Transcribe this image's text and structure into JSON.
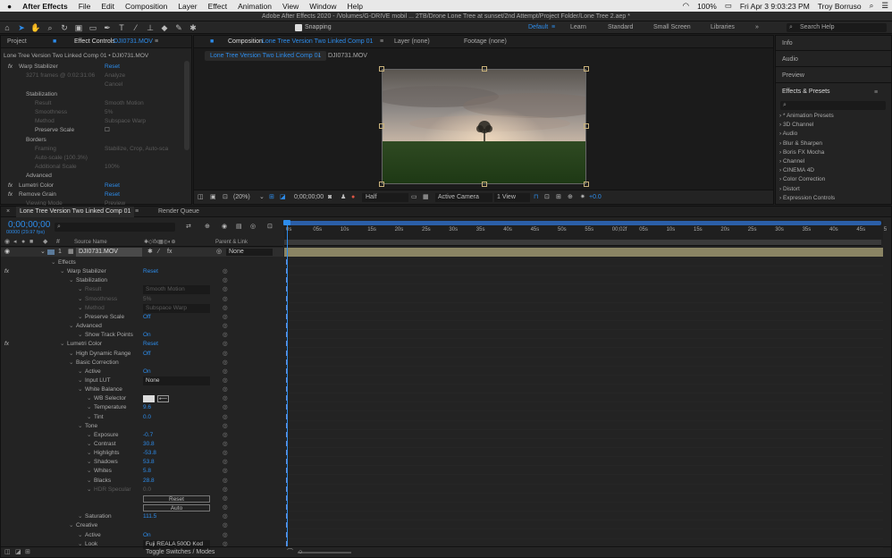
{
  "menubar": {
    "apple": "",
    "app": "After Effects",
    "items": [
      "File",
      "Edit",
      "Composition",
      "Layer",
      "Effect",
      "Animation",
      "View",
      "Window",
      "Help"
    ],
    "battery": "100%",
    "date": "Fri Apr 3  9:03:23 PM",
    "user": "Troy Borruso"
  },
  "title": "Adobe After Effects 2020 - /Volumes/G-DRIVE mobil ... 2TB/Drone Lone Tree at sunset/2nd Attempt/Project Folder/Lone Tree 2.aep *",
  "toolbar": {
    "snapping": "Snapping",
    "workspaces": [
      "Default",
      "Learn",
      "Standard",
      "Small Screen",
      "Libraries"
    ],
    "search": "Search Help"
  },
  "left": {
    "tab_project": "Project",
    "tab_effect": "Effect Controls",
    "tab_effect_layer": "DJI0731.MOV",
    "crumb": "Lone Tree Version Two Linked Comp 01 • DJI0731.MOV",
    "rows": [
      {
        "t": "Warp Stabilizer",
        "v": "Reset",
        "fx": true
      },
      {
        "t": "3271 frames @ 0:02:31:06",
        "v": "Analyze",
        "d": true
      },
      {
        "t": "",
        "v": "Cancel",
        "d": true
      },
      {
        "t": "Stabilization",
        "v": ""
      },
      {
        "t": "Result",
        "v": "Smooth Motion",
        "d": true
      },
      {
        "t": "Smoothness",
        "v": "5%",
        "d": true
      },
      {
        "t": "Method",
        "v": "Subspace Warp",
        "d": true
      },
      {
        "t": "Preserve Scale",
        "v": "☐"
      },
      {
        "t": "Borders",
        "v": ""
      },
      {
        "t": "Framing",
        "v": "Stabilize, Crop, Auto-sca",
        "d": true
      },
      {
        "t": "Auto-scale (100.3%)",
        "v": "",
        "d": true
      },
      {
        "t": "Additional Scale",
        "v": "100%",
        "d": true
      },
      {
        "t": "Advanced",
        "v": ""
      },
      {
        "t": "Lumetri Color",
        "v": "Reset",
        "fx": true
      },
      {
        "t": "Remove Grain",
        "v": "Reset",
        "fx": true
      },
      {
        "t": "Viewing Mode",
        "v": "Preview",
        "d": true
      }
    ]
  },
  "comp": {
    "tab": "Composition",
    "tab_name": "Lone Tree Version Two Linked Comp 01",
    "layer_tab": "Layer (none)",
    "footage_tab": "Footage (none)",
    "sub1": "Lone Tree Version Two Linked Comp 01",
    "sub2": "DJI0731.MOV",
    "zoom": "(20%)",
    "time": "0;00;00;00",
    "res": "Half",
    "camera": "Active Camera",
    "views": "1 View",
    "exposure": "+0.0"
  },
  "right": {
    "info": "Info",
    "audio": "Audio",
    "preview": "Preview",
    "effects": "Effects & Presets",
    "list": [
      "* Animation Presets",
      "3D Channel",
      "Audio",
      "Blur & Sharpen",
      "Boris FX Mocha",
      "Channel",
      "CINEMA 4D",
      "Color Correction",
      "Distort",
      "Expression Controls"
    ]
  },
  "timeline": {
    "tab": "Lone Tree Version Two Linked Comp 01",
    "render": "Render Queue",
    "time": "0;00;00;00",
    "frames": "00000 (29.97 fps)",
    "col_source": "Source Name",
    "col_parent": "Parent & Link",
    "layer_num": "1",
    "layer_name": "DJI0731.MOV",
    "parent": "None",
    "ruler": [
      "0s",
      "05s",
      "10s",
      "15s",
      "20s",
      "25s",
      "30s",
      "35s",
      "40s",
      "45s",
      "50s",
      "55s",
      "00;02f",
      "05s",
      "10s",
      "15s",
      "20s",
      "25s",
      "30s",
      "35s",
      "40s",
      "45s",
      "5"
    ],
    "rows": [
      {
        "t": "Effects",
        "i": 0,
        "v": ""
      },
      {
        "t": "Warp Stabilizer",
        "i": 1,
        "v": "Reset",
        "fx": true
      },
      {
        "t": "Stabilization",
        "i": 2,
        "v": ""
      },
      {
        "t": "Result",
        "i": 3,
        "v": "Smooth Motion",
        "d": true
      },
      {
        "t": "Smoothness",
        "i": 3,
        "v": "5%",
        "d": true
      },
      {
        "t": "Method",
        "i": 3,
        "v": "Subspace Warp",
        "d": true
      },
      {
        "t": "Preserve Scale",
        "i": 3,
        "v": "Off"
      },
      {
        "t": "Advanced",
        "i": 2,
        "v": ""
      },
      {
        "t": "Show Track Points",
        "i": 3,
        "v": "On"
      },
      {
        "t": "Lumetri Color",
        "i": 1,
        "v": "Reset",
        "fx": true
      },
      {
        "t": "High Dynamic Range",
        "i": 2,
        "v": "Off"
      },
      {
        "t": "Basic Correction",
        "i": 2,
        "v": ""
      },
      {
        "t": "Active",
        "i": 3,
        "v": "On"
      },
      {
        "t": "Input LUT",
        "i": 3,
        "v": "None"
      },
      {
        "t": "White Balance",
        "i": 3,
        "v": ""
      },
      {
        "t": "WB Selector",
        "i": 4,
        "v": ""
      },
      {
        "t": "Temperature",
        "i": 4,
        "v": "9.6"
      },
      {
        "t": "Tint",
        "i": 4,
        "v": "0.0"
      },
      {
        "t": "Tone",
        "i": 3,
        "v": ""
      },
      {
        "t": "Exposure",
        "i": 4,
        "v": "-0.7"
      },
      {
        "t": "Contrast",
        "i": 4,
        "v": "30.8"
      },
      {
        "t": "Highlights",
        "i": 4,
        "v": "-53.8"
      },
      {
        "t": "Shadows",
        "i": 4,
        "v": "53.8"
      },
      {
        "t": "Whites",
        "i": 4,
        "v": "5.8"
      },
      {
        "t": "Blacks",
        "i": 4,
        "v": "28.8"
      },
      {
        "t": "HDR Specular",
        "i": 4,
        "v": "0.0",
        "d": true
      },
      {
        "t": "",
        "i": 4,
        "v": "Reset"
      },
      {
        "t": "",
        "i": 4,
        "v": "Auto"
      },
      {
        "t": "Saturation",
        "i": 3,
        "v": "111.5"
      },
      {
        "t": "Creative",
        "i": 2,
        "v": ""
      },
      {
        "t": "Active",
        "i": 3,
        "v": "On"
      },
      {
        "t": "Look",
        "i": 3,
        "v": "Fuji REALA 500D Kod"
      }
    ],
    "footer": "Toggle Switches / Modes"
  }
}
